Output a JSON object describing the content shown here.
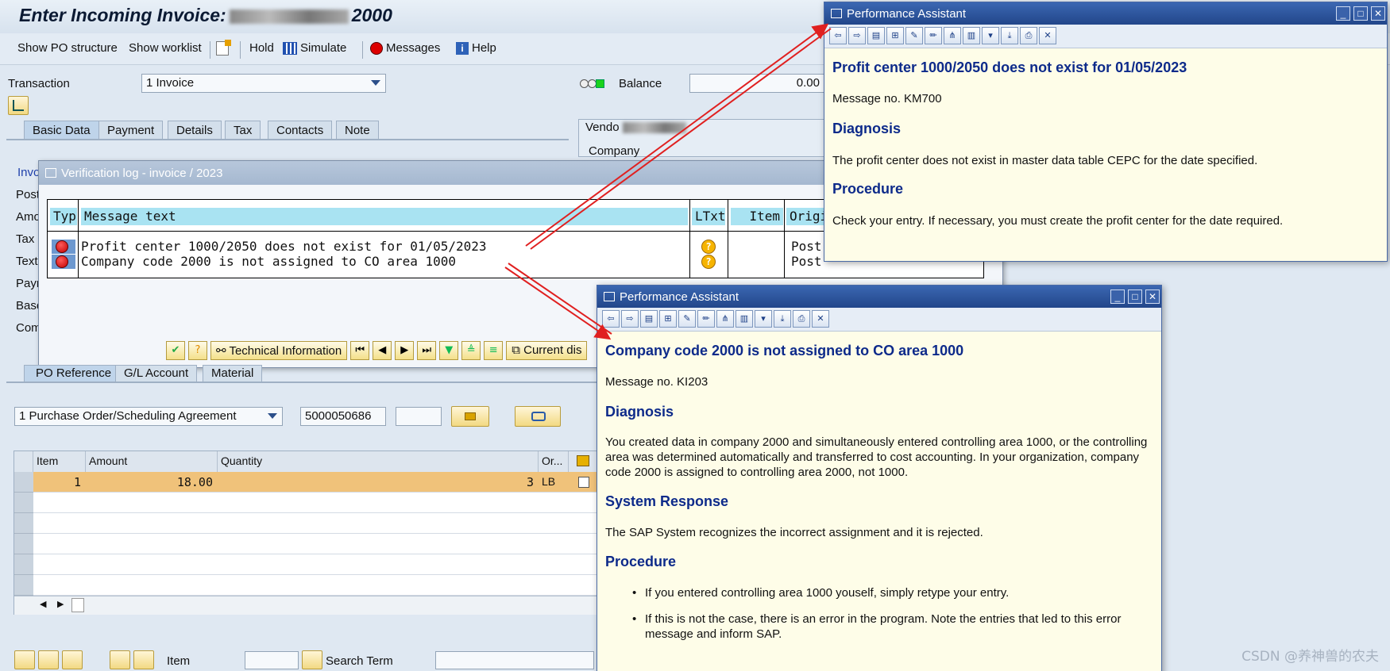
{
  "main": {
    "title_prefix": "Enter Incoming Invoice:",
    "title_suffix": "2000",
    "toolbar": {
      "show_po": "Show PO structure",
      "show_worklist": "Show worklist",
      "hold": "Hold",
      "simulate": "Simulate",
      "messages": "Messages",
      "help": "Help"
    },
    "transaction_label": "Transaction",
    "transaction_value": "1 Invoice",
    "balance_label": "Balance",
    "balance_value": "0.00",
    "tabs": [
      "Basic Data",
      "Payment",
      "Details",
      "Tax",
      "Contacts",
      "Note"
    ],
    "vendor_label": "Vendo",
    "company_label": "Company",
    "left_labels": [
      "Invo",
      "Post",
      "Amo",
      "Tax",
      "Text",
      "Payn",
      "Base",
      "Com"
    ],
    "po_tabs": [
      "PO Reference",
      "G/L Account",
      "Material"
    ],
    "po_type": "1 Purchase Order/Scheduling Agreement",
    "po_number": "5000050686",
    "grid": {
      "headers": [
        "Item",
        "Amount",
        "Quantity",
        "Or..."
      ],
      "rows": [
        {
          "item": "1",
          "amount": "18.00",
          "quantity": "3",
          "unit": "LB"
        }
      ]
    },
    "bottom": {
      "item_label": "Item",
      "search_term_label": "Search Term"
    }
  },
  "verification": {
    "title": "Verification log - invoice  / 2023",
    "headers": {
      "typ": "Typ",
      "message": "Message text",
      "ltxt": "LTxt",
      "item": "Item",
      "origin": "Origin"
    },
    "rows": [
      {
        "message": "Profit center 1000/2050 does not exist for 01/05/2023",
        "origin": "Post"
      },
      {
        "message": "Company code 2000 is not assigned to CO area 1000",
        "origin": "Post"
      }
    ],
    "buttons": {
      "technical": "Technical Information",
      "current": "Current dis"
    }
  },
  "pa1": {
    "title": "Performance Assistant",
    "heading": "Profit center 1000/2050 does not exist for 01/05/2023",
    "message_no": "Message no. KM700",
    "diagnosis_h": "Diagnosis",
    "diagnosis": "The profit center does not exist in master data table CEPC for the date specified.",
    "procedure_h": "Procedure",
    "procedure": "Check your entry. If necessary, you must create the profit center for the date required."
  },
  "pa2": {
    "title": "Performance Assistant",
    "heading": "Company code 2000 is not assigned to CO area 1000",
    "message_no": "Message no. KI203",
    "diagnosis_h": "Diagnosis",
    "diagnosis": "You created data in company 2000 and simultaneously entered controlling area 1000, or the controlling area was determined automatically and transferred to cost accounting. In your organization, company code 2000 is assigned to controlling area 2000, not 1000.",
    "system_h": "System Response",
    "system": "The SAP System recognizes the incorrect assignment and it is rejected.",
    "procedure_h": "Procedure",
    "bullet1": "If you entered controlling area 1000 youself, simply retype your entry.",
    "bullet2": "If this is not the case, there is an error in the program. Note the entries that led to this error message and inform SAP."
  },
  "watermark": "CSDN @养神兽的农夫",
  "colors": {
    "pa_heading": "#0d2a8a",
    "arrow": "#e02020",
    "row_highlight": "#f0c27a",
    "pa_bg": "#fefde8"
  }
}
